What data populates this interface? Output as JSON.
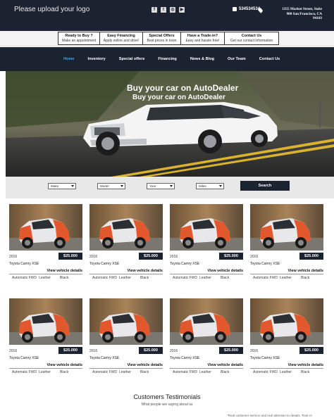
{
  "header": {
    "logo_text": "Please upload your logo",
    "social": [
      {
        "icon": "facebook-icon",
        "glyph": "f"
      },
      {
        "icon": "twitter-icon",
        "glyph": "t"
      },
      {
        "icon": "instagram-icon",
        "glyph": "◎"
      },
      {
        "icon": "youtube-icon",
        "glyph": "▶"
      }
    ],
    "phone": "534534534",
    "address_line1": "1355 Market Street, Suite",
    "address_line2": "900 San Francisco, CA",
    "address_line3": "94103"
  },
  "infobar": [
    {
      "title": "Ready to Buy ?",
      "subtitle": "Make an appointment"
    },
    {
      "title": "Easy Financing",
      "subtitle": "Apply online and drive!"
    },
    {
      "title": "Special Offers",
      "subtitle": "Best prices in town"
    },
    {
      "title": "Have a Trade-in?",
      "subtitle": "Easy and hassle free!"
    },
    {
      "title": "Contact Us",
      "subtitle": "Get our contact information"
    }
  ],
  "nav": {
    "items": [
      "Home",
      "Inventory",
      "Special offers",
      "Financing",
      "News & Blog",
      "Our Team",
      "Contact Us"
    ],
    "active_index": 0
  },
  "hero": {
    "headline": "Buy your car on AutoDealer",
    "subheadline": "Buy your car on AutoDealer"
  },
  "search": {
    "selects": [
      "Make",
      "Model",
      "Year",
      "Miles"
    ],
    "button_label": "Search"
  },
  "listings": [
    {
      "year": "2016",
      "price": "$25.000",
      "model": "Toyota Camry XSE",
      "details_label": "View vehicle details",
      "transmission": "Automatic FWD",
      "interior": "Leather",
      "color": "Black"
    },
    {
      "year": "2016",
      "price": "$25.000",
      "model": "Toyota Camry XSE",
      "details_label": "View vehicle details",
      "transmission": "Automatic FWD",
      "interior": "Leather",
      "color": "Black"
    },
    {
      "year": "2016",
      "price": "$25.000",
      "model": "Toyota Camry XSE",
      "details_label": "View vehicle details",
      "transmission": "Automatic FWD",
      "interior": "Leather",
      "color": "Black"
    },
    {
      "year": "2016",
      "price": "$25.000",
      "model": "Toyota Camry XSE",
      "details_label": "View vehicle details",
      "transmission": "Automatic FWD",
      "interior": "Leather",
      "color": "Black"
    },
    {
      "year": "2016",
      "price": "$25.000",
      "model": "Toyota Camry XSE",
      "details_label": "View vehicle details",
      "transmission": "Automatic FWD",
      "interior": "Leather",
      "color": "Black"
    },
    {
      "year": "2016",
      "price": "$25.000",
      "model": "Toyota Camry XSE",
      "details_label": "View vehicle details",
      "transmission": "Automatic FWD",
      "interior": "Leather",
      "color": "Black"
    },
    {
      "year": "2016",
      "price": "$25.000",
      "model": "Toyota Camry XSE",
      "details_label": "View vehicle details",
      "transmission": "Automatic FWD",
      "interior": "Leather",
      "color": "Black"
    },
    {
      "year": "2016",
      "price": "$25.000",
      "model": "Toyota Camry XSE",
      "details_label": "View vehicle details",
      "transmission": "Automatic FWD",
      "interior": "Leather",
      "color": "Black"
    }
  ],
  "testimonials": {
    "title": "Customers Testimonials",
    "subtitle": "What people are saying about us",
    "quote_snippet": "\"Real customer service and real attention to details. Took m"
  },
  "colors": {
    "dark_navy": "#1b2230",
    "nav_active": "#4aa3df",
    "car_accent": "#e2572b"
  }
}
